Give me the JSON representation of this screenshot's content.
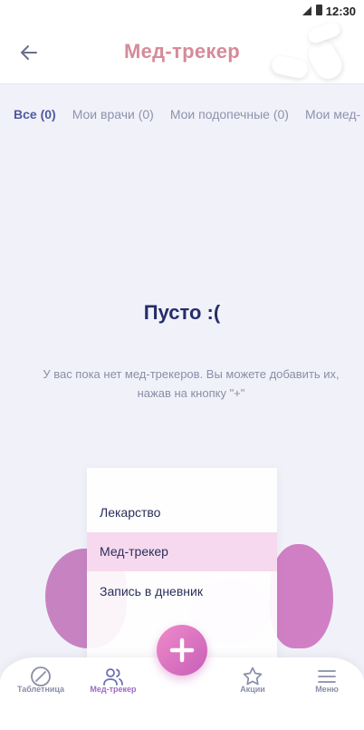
{
  "status_bar": {
    "time": "12:30"
  },
  "header": {
    "title": "Мед-трекер"
  },
  "tabs": [
    {
      "label": "Все (0)",
      "active": true
    },
    {
      "label": "Мои врачи (0)",
      "active": false
    },
    {
      "label": "Мои подопечные (0)",
      "active": false
    },
    {
      "label": "Мои мед-",
      "active": false
    }
  ],
  "empty": {
    "title": "Пусто :(",
    "text": "У вас пока нет мед-трекеров. Вы можете добавить их, нажав на кнопку \"+\""
  },
  "menu": {
    "items": [
      {
        "label": "Лекарство"
      },
      {
        "label": "Мед-трекер",
        "highlighted": true
      },
      {
        "label": "Запись в дневник"
      }
    ]
  },
  "nav": {
    "items": [
      {
        "label": "Таблетница",
        "icon": "pill-slash-icon"
      },
      {
        "label": "Мед-трекер",
        "icon": "users-icon",
        "active": true
      },
      {
        "label": "Акции",
        "icon": "star-icon"
      },
      {
        "label": "Меню",
        "icon": "menu-icon"
      }
    ]
  },
  "colors": {
    "accent": "#4f5aa1",
    "title_pink": "#d58b98",
    "fab": "#e07ac6",
    "menu_highlight": "#f6d9ee"
  }
}
